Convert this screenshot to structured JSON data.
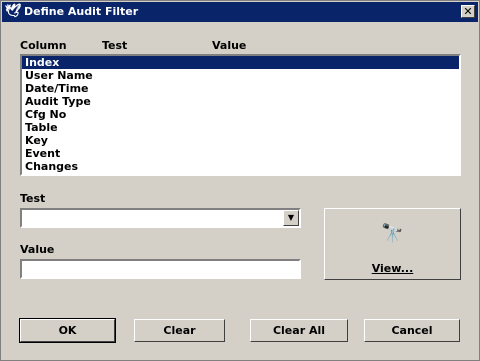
{
  "window": {
    "title": "Define Audit Filter",
    "close_label": "✕",
    "app_icon": "🕊"
  },
  "columns": {
    "column": "Column",
    "test": "Test",
    "value": "Value"
  },
  "list": {
    "selected_index": 0,
    "items": [
      "Index",
      "User Name",
      "Date/Time",
      "Audit Type",
      "Cfg No",
      "Table",
      "Key",
      "Event",
      "Changes"
    ]
  },
  "test": {
    "label": "Test",
    "value": "",
    "arrow": "▼"
  },
  "value": {
    "label": "Value",
    "value": "",
    "placeholder": ""
  },
  "view_button": {
    "label": "View...",
    "icon": "binoculars-icon",
    "glyph": "🔭"
  },
  "buttons": {
    "ok": "OK",
    "clear": "Clear",
    "clear_all": "Clear All",
    "cancel": "Cancel"
  },
  "colors": {
    "titlebar": "#0a246a",
    "face": "#d4d0c8",
    "selection": "#0a246a"
  }
}
